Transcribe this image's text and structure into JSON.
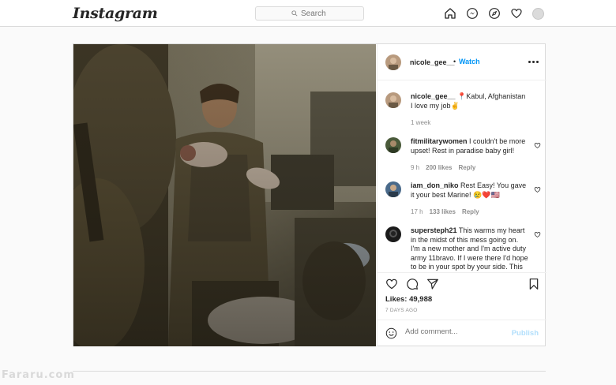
{
  "header": {
    "logo": "Instagram",
    "search_placeholder": "Search"
  },
  "post": {
    "username": "nicole_gee__",
    "separator": "•",
    "watch_label": "Watch",
    "caption": {
      "username": "nicole_gee__",
      "text": "📍Kabul, Afghanistan I love my job✌️",
      "time": "1 week"
    },
    "comments": [
      {
        "username": "fitmilitarywomen",
        "text": "I couldn't be more upset! Rest in paradise baby girl!",
        "time": "9 h",
        "likes": "200 likes",
        "reply": "Reply"
      },
      {
        "username": "iam_don_niko",
        "text": "Rest Easy! You gave it your best Marine! 😢❤️🇺🇸",
        "time": "17 h",
        "likes": "133 likes",
        "reply": "Reply"
      },
      {
        "username": "supersteph21",
        "text": "This warms my heart in the midst of this mess going on. I'm a new mother and I'm active duty army 11bravo. If I were there I'd hope to be in your spot by your side. This",
        "time": "",
        "likes": "",
        "reply": ""
      }
    ],
    "likes": "Likes: 49,988",
    "posted_ago": "7 DAYS AGO",
    "add_comment_placeholder": "Add comment...",
    "publish_label": "Publish"
  },
  "watermark": "Fararu.com",
  "colors": {
    "link_blue": "#0095f6",
    "publish_disabled": "#b2dffc",
    "border": "#dbdbdb"
  }
}
